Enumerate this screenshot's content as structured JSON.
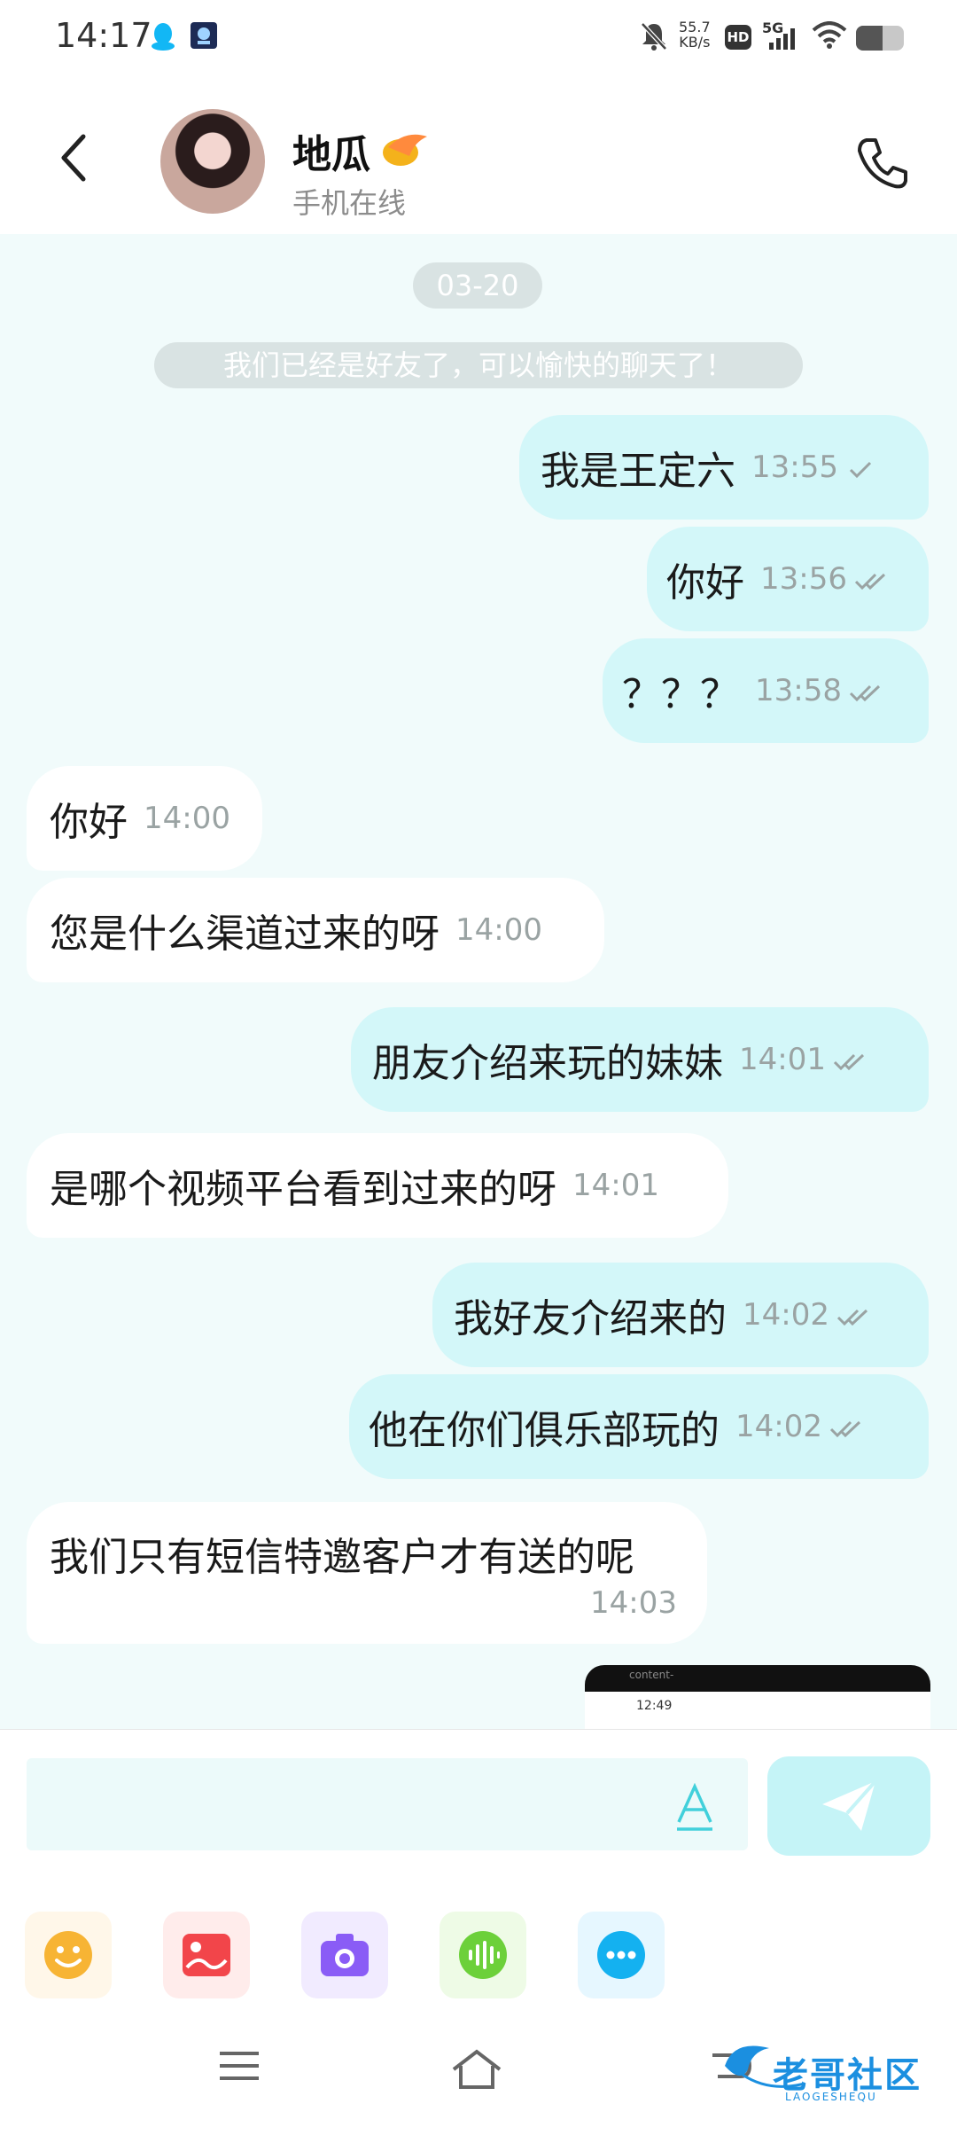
{
  "status_bar": {
    "time": "14:17",
    "net_speed_value": "55.7",
    "net_speed_unit": "KB/s",
    "hd": "HD",
    "signal": "5G",
    "battery_level": 0.55
  },
  "header": {
    "contact_name": "地瓜",
    "contact_status": "手机在线"
  },
  "chat": {
    "date": "03-20",
    "system_notice": "我们已经是好友了，可以愉快的聊天了！",
    "messages": [
      {
        "dir": "out",
        "text": "我是王定六",
        "time": "13:55",
        "read": false
      },
      {
        "dir": "out",
        "text": "你好",
        "time": "13:56",
        "read": true
      },
      {
        "dir": "out",
        "text": "？？？",
        "time": "13:58",
        "read": true
      },
      {
        "dir": "in",
        "text": "你好",
        "time": "14:00"
      },
      {
        "dir": "in",
        "text": "您是什么渠道过来的呀",
        "time": "14:00"
      },
      {
        "dir": "out",
        "text": "朋友介绍来玩的妹妹",
        "time": "14:01",
        "read": true
      },
      {
        "dir": "in",
        "text": "是哪个视频平台看到过来的呀",
        "time": "14:01"
      },
      {
        "dir": "out",
        "text": "我好友介绍来的",
        "time": "14:02",
        "read": true
      },
      {
        "dir": "out",
        "text": "他在你们俱乐部玩的",
        "time": "14:02",
        "read": true
      },
      {
        "dir": "in",
        "text": "我们只有短信特邀客户才有送的呢",
        "time": "14:03"
      }
    ],
    "image_preview": {
      "top_text": "content-",
      "time": "12:49"
    }
  },
  "input": {
    "placeholder": ""
  },
  "tools": [
    "emoji-icon",
    "image-icon",
    "camera-icon",
    "voice-icon",
    "more-icon"
  ],
  "watermark": {
    "text": "老哥社区",
    "subtext": "LAOGESHEQU"
  },
  "colors": {
    "outgoing_bubble": "#d3f7f9",
    "incoming_bubble": "#ffffff",
    "chat_background": "#f1fbfb",
    "accent": "#34c8d6"
  }
}
